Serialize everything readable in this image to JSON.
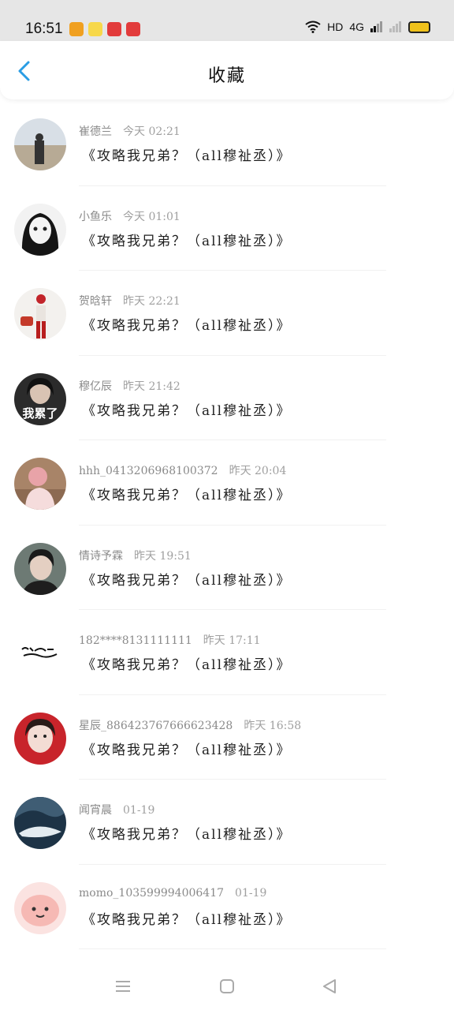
{
  "status_bar": {
    "time": "16:51",
    "network": "HD",
    "signal": "4G"
  },
  "header": {
    "title": "收藏"
  },
  "favorites": [
    {
      "author": "崔德兰",
      "time": "今天 02:21",
      "title": "《攻略我兄弟？（all穆祉丞）》"
    },
    {
      "author": "小鱼乐",
      "time": "今天 01:01",
      "title": "《攻略我兄弟？（all穆祉丞）》"
    },
    {
      "author": "贺晗轩",
      "time": "昨天 22:21",
      "title": "《攻略我兄弟？（all穆祉丞）》"
    },
    {
      "author": "穆亿辰",
      "time": "昨天 21:42",
      "title": "《攻略我兄弟？（all穆祉丞）》"
    },
    {
      "author": "hhh_0413206968100372",
      "time": "昨天 20:04",
      "title": "《攻略我兄弟？（all穆祉丞）》"
    },
    {
      "author": "情诗予霖",
      "time": "昨天 19:51",
      "title": "《攻略我兄弟？（all穆祉丞）》"
    },
    {
      "author": "182****8131111111",
      "time": "昨天 17:11",
      "title": "《攻略我兄弟？（all穆祉丞）》"
    },
    {
      "author": "星辰_886423767666623428",
      "time": "昨天 16:58",
      "title": "《攻略我兄弟？（all穆祉丞）》"
    },
    {
      "author": "闻宵晨",
      "time": "01-19",
      "title": "《攻略我兄弟？（all穆祉丞）》"
    },
    {
      "author": "momo_103599994006417",
      "time": "01-19",
      "title": "《攻略我兄弟？（all穆祉丞）》"
    }
  ],
  "avatar_text": {
    "item4": "我累了"
  },
  "colors": {
    "accent": "#2a9de4",
    "background": "#ffffff",
    "status_bar": "#e6e6e6"
  }
}
